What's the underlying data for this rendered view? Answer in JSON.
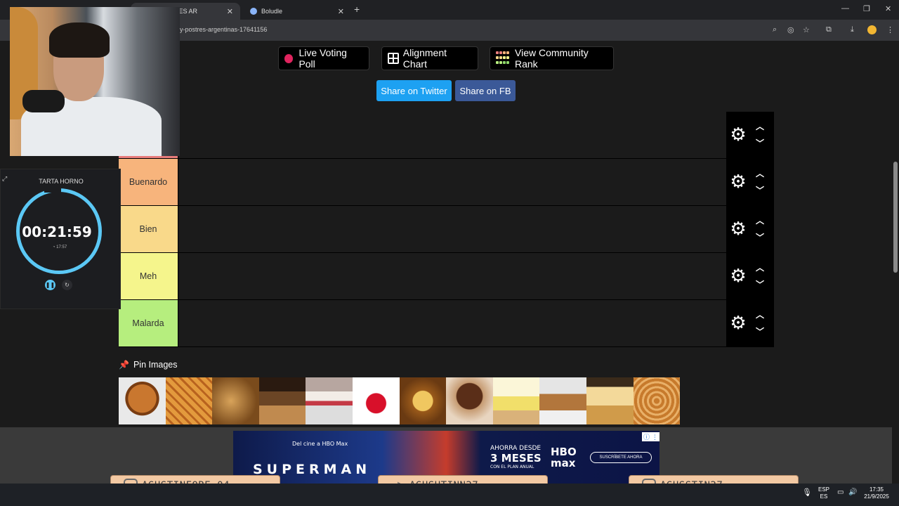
{
  "browser": {
    "tab_active_label": "TAS Y POSTRES AR",
    "tab_other_label": "Boludle",
    "url": "y-postres-argentinas-17641156"
  },
  "toolbar": {
    "live_voting_label": "Live Voting Poll",
    "alignment_label": "Alignment Chart",
    "community_rank_label": "View Community Rank",
    "share_twitter_label": "Share on Twitter",
    "share_fb_label": "Share on FB"
  },
  "tiers": [
    {
      "label": "",
      "color": "#e87c7c"
    },
    {
      "label": "Buenardo",
      "color": "#f7b47c"
    },
    {
      "label": "Bien",
      "color": "#f9d98a"
    },
    {
      "label": "Meh",
      "color": "#f5f58c"
    },
    {
      "label": "Malarda",
      "color": "#b6ee7e"
    }
  ],
  "pin": {
    "title": "Pin Images",
    "images": [
      "pastafrola",
      "pastafrola-2",
      "torta-crumble",
      "chocotorta",
      "cheesecake",
      "gelatina",
      "flan",
      "mousse-chocolate",
      "lemon-pie",
      "tarta-coco",
      "tarta-ricota",
      "tarta-manzana"
    ]
  },
  "ad": {
    "line1": "Del cine a HBO Max",
    "line2": "SUPERMAN",
    "offer_top": "AHORRA DESDE",
    "offer_big": "3 MESES",
    "offer_small": "CON EL PLAN ANUAL",
    "brand": "HBO max",
    "cta": "SUSCRÍBETE AHORA"
  },
  "socials": [
    {
      "handle": "AGUSTINFORE_04",
      "icon": "instagram-icon"
    },
    {
      "handle": "AGUSHTINN27",
      "icon": "tiktok-icon"
    },
    {
      "handle": "AGUSSTIN27",
      "icon": "youtube-icon"
    }
  ],
  "timer": {
    "title": "TARTA HORNO",
    "value": "00:21:59",
    "sub": "17:57"
  },
  "tray": {
    "lang_top": "ESP",
    "lang_bottom": "ES",
    "time": "17:35",
    "date": "21/9/2025"
  }
}
